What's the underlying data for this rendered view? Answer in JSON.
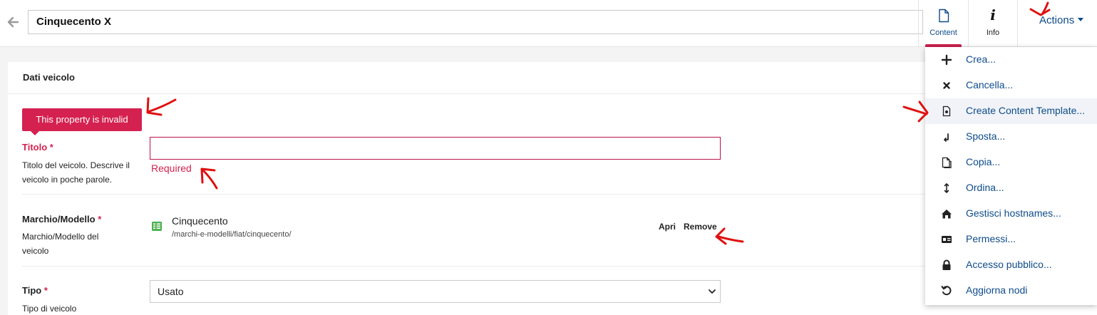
{
  "header": {
    "node_title": "Cinquecento X",
    "tabs": [
      {
        "label": "Content",
        "icon": "document-icon",
        "active": true
      },
      {
        "label": "Info",
        "icon": "info-icon",
        "active": false
      }
    ],
    "actions_label": "Actions"
  },
  "form": {
    "section_title": "Dati veicolo",
    "validation_tooltip": "This property is invalid",
    "fields": {
      "titolo": {
        "label": "Titolo",
        "required_mark": "*",
        "help": "Titolo del veicolo. Descrive il veicolo in poche parole.",
        "value": "",
        "error": "Required"
      },
      "marchio": {
        "label": "Marchio/Modello",
        "required_mark": "*",
        "help": "Marchio/Modello del veicolo",
        "ref_name": "Cinquecento",
        "ref_path": "/marchi-e-modelli/fiat/cinquecento/",
        "open_label": "Apri",
        "remove_label": "Remove"
      },
      "tipo": {
        "label": "Tipo",
        "required_mark": "*",
        "help": "Tipo di veicolo",
        "selected": "Usato"
      }
    }
  },
  "menu": {
    "items": [
      {
        "label": "Crea...",
        "icon": "plus-icon"
      },
      {
        "label": "Cancella...",
        "icon": "close-icon"
      },
      {
        "label": "Create Content Template...",
        "icon": "template-icon",
        "highlighted": true
      },
      {
        "label": "Sposta...",
        "icon": "move-icon"
      },
      {
        "label": "Copia...",
        "icon": "copy-icon"
      },
      {
        "label": "Ordina...",
        "icon": "sort-icon"
      },
      {
        "label": "Gestisci hostnames...",
        "icon": "home-icon"
      },
      {
        "label": "Permessi...",
        "icon": "id-card-icon"
      },
      {
        "label": "Accesso pubblico...",
        "icon": "lock-icon"
      },
      {
        "label": "Aggiorna nodi",
        "icon": "refresh-icon"
      }
    ]
  },
  "colors": {
    "accent": "#d4214f",
    "link": "#0e4b8a",
    "annotation": "#e01010"
  }
}
